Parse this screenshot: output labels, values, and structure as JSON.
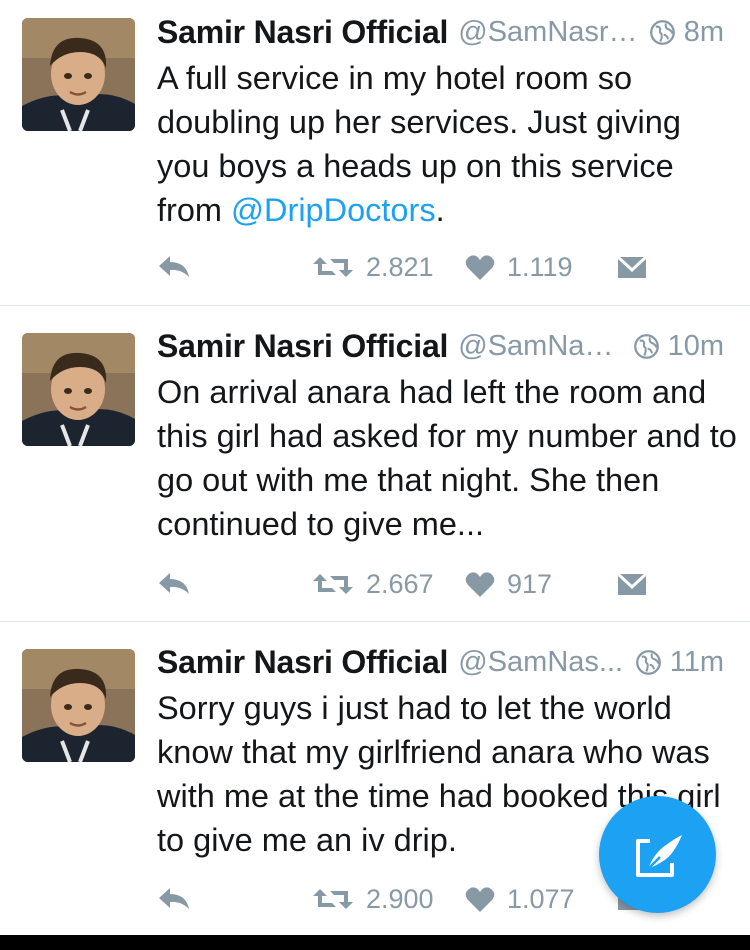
{
  "tweets": [
    {
      "name": "Samir Nasri Official",
      "handle": "@SamNasri...",
      "time": "8m",
      "text_before": "A full service in my hotel room so doubling up her services. Just giving you boys a heads up on this service from ",
      "mention": "@DripDoctors",
      "text_after": ".",
      "retweets": "2.821",
      "likes": "1.119"
    },
    {
      "name": "Samir Nasri Official",
      "handle": "@SamNas...",
      "time": "10m",
      "text_before": "On arrival anara had left the room and this girl had asked for my number and to go out with me that night. She then continued to give me...",
      "mention": "",
      "text_after": "",
      "retweets": "2.667",
      "likes": "917"
    },
    {
      "name": "Samir Nasri Official",
      "handle": "@SamNas...",
      "time": "11m",
      "text_before": "Sorry guys i just had to let the world know that my girlfriend anara who was with me at the time had booked this girl to give me an iv drip.",
      "mention": "",
      "text_after": "",
      "retweets": "2.900",
      "likes": "1.077"
    }
  ],
  "icons": {
    "reply": "reply-icon",
    "retweet": "retweet-icon",
    "like": "heart-icon",
    "dm": "envelope-icon",
    "globe": "globe-icon",
    "compose": "compose-icon"
  },
  "colors": {
    "accent": "#1da1f2",
    "muted": "#8899a6",
    "text": "#14171a"
  }
}
